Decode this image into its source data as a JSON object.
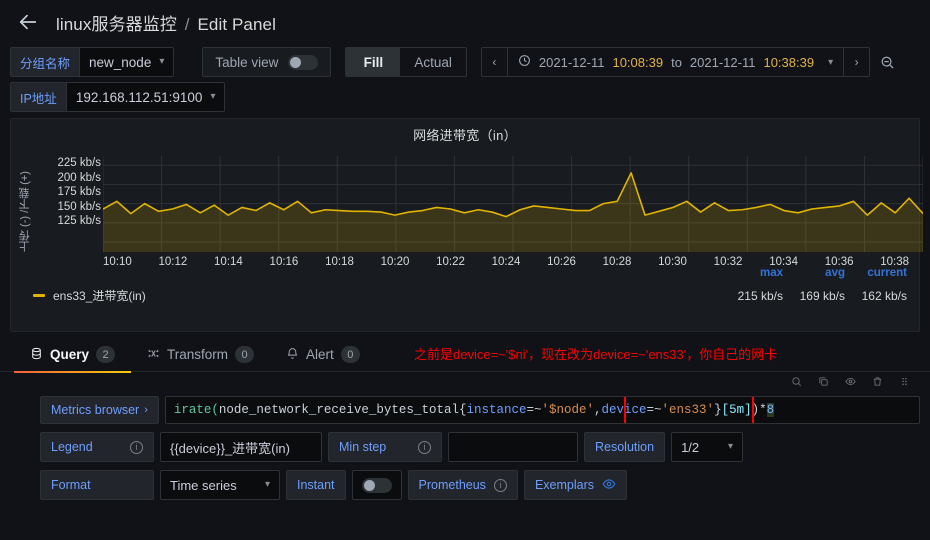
{
  "header": {
    "back_icon": "arrow-left-icon",
    "dashboard_title": "linux服务器监控",
    "separator": "/",
    "page_title": "Edit Panel"
  },
  "variables": [
    {
      "label": "分组名称",
      "value": "new_node"
    },
    {
      "label": "IP地址",
      "value": "192.168.112.51:9100"
    }
  ],
  "toolbar": {
    "table_view_label": "Table view",
    "table_view_on": false,
    "fill_label": "Fill",
    "actual_label": "Actual",
    "fill_active": true,
    "time_prev": "‹",
    "time_next": "›",
    "clock_icon": "clock-icon",
    "time_from_date": "2021-12-11",
    "time_from_time": "10:08:39",
    "time_to_word": "to",
    "time_to_date": "2021-12-11",
    "time_to_time": "10:38:39",
    "zoom_icon": "zoom-out-icon"
  },
  "panel": {
    "title": "网络进带宽（in）",
    "y_axis_label": "上传 (-) /下载 (+)",
    "legend": {
      "columns": [
        "max",
        "avg",
        "current"
      ],
      "series_name": "ens33_进带宽(in)",
      "values": [
        "215 kb/s",
        "169 kb/s",
        "162 kb/s"
      ],
      "color": "#e0b400"
    }
  },
  "chart_data": {
    "type": "area",
    "title": "网络进带宽（in）",
    "xlabel": "",
    "ylabel": "上传 (-) /下载 (+)",
    "ylim": [
      112,
      237
    ],
    "yticks": [
      "225 kb/s",
      "200 kb/s",
      "175 kb/s",
      "150 kb/s",
      "125 kb/s"
    ],
    "ytick_values": [
      225,
      200,
      175,
      150,
      125
    ],
    "xticks": [
      "10:10",
      "10:12",
      "10:14",
      "10:16",
      "10:18",
      "10:20",
      "10:22",
      "10:24",
      "10:26",
      "10:28",
      "10:30",
      "10:32",
      "10:34",
      "10:36",
      "10:38"
    ],
    "grid": true,
    "legend_position": "bottom-right",
    "line_color": "#e0b400",
    "fill_color": "rgba(224,180,0,0.18)",
    "series": [
      {
        "name": "ens33_进带宽(in)",
        "stats": {
          "max": 215,
          "avg": 169,
          "current": 162
        },
        "values": [
          168,
          178,
          162,
          175,
          165,
          168,
          174,
          163,
          173,
          160,
          170,
          166,
          176,
          167,
          178,
          163,
          167,
          166,
          165,
          165,
          164,
          160,
          164,
          166,
          170,
          168,
          163,
          167,
          164,
          158,
          167,
          172,
          170,
          168,
          166,
          166,
          175,
          178,
          215,
          160,
          165,
          170,
          178,
          164,
          176,
          166,
          167,
          170,
          174,
          166,
          163,
          168,
          170,
          172,
          178,
          160,
          176,
          163,
          182,
          162
        ]
      }
    ]
  },
  "tabs": [
    {
      "label": "Query",
      "badge": "2",
      "icon": "database-icon",
      "active": true
    },
    {
      "label": "Transform",
      "badge": "0",
      "icon": "transform-icon",
      "active": false
    },
    {
      "label": "Alert",
      "badge": "0",
      "icon": "bell-icon",
      "active": false
    }
  ],
  "annotation": "之前是device=~'$ni'，现在改为device=~'ens33'，你自己的网卡",
  "query_editor": {
    "metrics_browser_label": "Metrics browser",
    "metrics_browser_chevron": "›",
    "expression_parts": {
      "fn": "irate(",
      "metric": "node_network_receive_bytes_total{",
      "label1": "instance",
      "op1": "=~",
      "val1": "'$node'",
      "comma": ",",
      "label2": "device",
      "op2": "=~",
      "val2": "'ens33'",
      "close_brace": "}",
      "range": "[5m]",
      "close_paren": ")",
      "multiply": "*",
      "factor": "8"
    },
    "expression_full": "irate(node_network_receive_bytes_total{instance=~'$node',device=~'ens33'}[5m])*8",
    "highlight_box": "device=~'ens33'",
    "fields": {
      "legend_label": "Legend",
      "legend_value": "{{device}}_进带宽(in)",
      "min_step_label": "Min step",
      "min_step_value": "",
      "resolution_label": "Resolution",
      "resolution_value": "1/2",
      "format_label": "Format",
      "format_value": "Time series",
      "instant_label": "Instant",
      "instant_on": false,
      "prometheus_label": "Prometheus",
      "exemplars_label": "Exemplars",
      "exemplars_icon": "eye-icon"
    }
  }
}
